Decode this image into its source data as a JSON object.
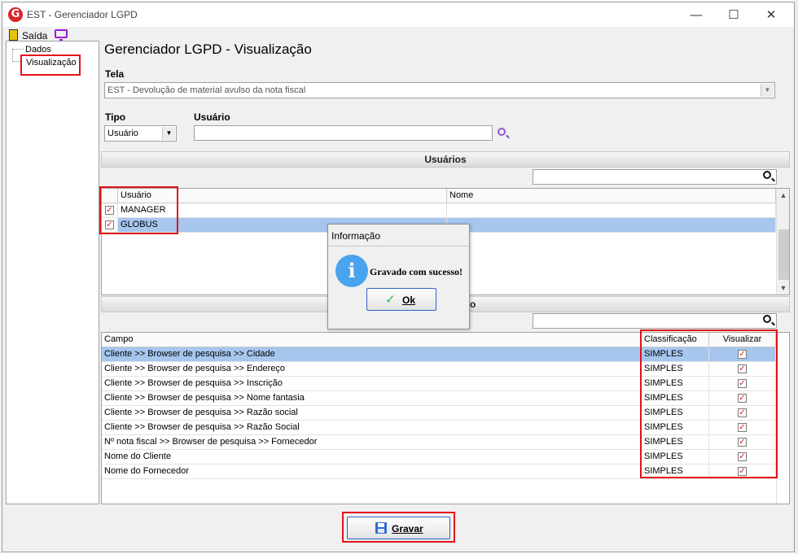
{
  "window": {
    "title": "EST - Gerenciador LGPD",
    "minimize": "—",
    "maximize": "☐",
    "close": "✕"
  },
  "menu": {
    "exit_label": "Saída"
  },
  "tree": {
    "items": [
      "Dados",
      "Visualização"
    ]
  },
  "page_title": "Gerenciador LGPD - Visualização",
  "form": {
    "tela_label": "Tela",
    "tela_value": "EST - Devolução de material avulso da nota fiscal",
    "tipo_label": "Tipo",
    "tipo_value": "Usuário",
    "usuario_label": "Usuário",
    "usuario_value": ""
  },
  "users_section": {
    "title": "Usuários",
    "columns": [
      "Usuário",
      "Nome"
    ],
    "rows": [
      {
        "user": "MANAGER",
        "name": "",
        "checked": true,
        "selected": false
      },
      {
        "user": "GLOBUS",
        "name": "",
        "checked": true,
        "selected": true
      }
    ]
  },
  "fields_section": {
    "title_visible_fragment": "o",
    "columns": [
      "Campo",
      "Classificação",
      "Visualizar"
    ],
    "rows": [
      {
        "field": "Cliente >> Browser de pesquisa >> Cidade",
        "classification": "SIMPLES",
        "visible": true,
        "selected": true
      },
      {
        "field": "Cliente >> Browser de pesquisa >> Endereço",
        "classification": "SIMPLES",
        "visible": true,
        "selected": false
      },
      {
        "field": "Cliente >> Browser de pesquisa >> Inscrição",
        "classification": "SIMPLES",
        "visible": true,
        "selected": false
      },
      {
        "field": "Cliente >> Browser de pesquisa >> Nome fantasia",
        "classification": "SIMPLES",
        "visible": true,
        "selected": false
      },
      {
        "field": "Cliente >> Browser de pesquisa >> Razão social",
        "classification": "SIMPLES",
        "visible": true,
        "selected": false
      },
      {
        "field": "Cliente >> Browser de pesquisa >> Razão Social",
        "classification": "SIMPLES",
        "visible": true,
        "selected": false
      },
      {
        "field": "Nº nota fiscal >> Browser de pesquisa >> Fornecedor",
        "classification": "SIMPLES",
        "visible": true,
        "selected": false
      },
      {
        "field": "Nome do Cliente",
        "classification": "SIMPLES",
        "visible": true,
        "selected": false
      },
      {
        "field": "Nome do Fornecedor",
        "classification": "SIMPLES",
        "visible": true,
        "selected": false
      }
    ]
  },
  "dialog": {
    "title": "Informação",
    "message": "Gravado com sucesso!",
    "ok_label": "Ok"
  },
  "save_button": {
    "label": "Gravar"
  },
  "colors": {
    "highlight": "#e3121a",
    "selection": "#a6c6ee",
    "check": "#d21b1b"
  }
}
